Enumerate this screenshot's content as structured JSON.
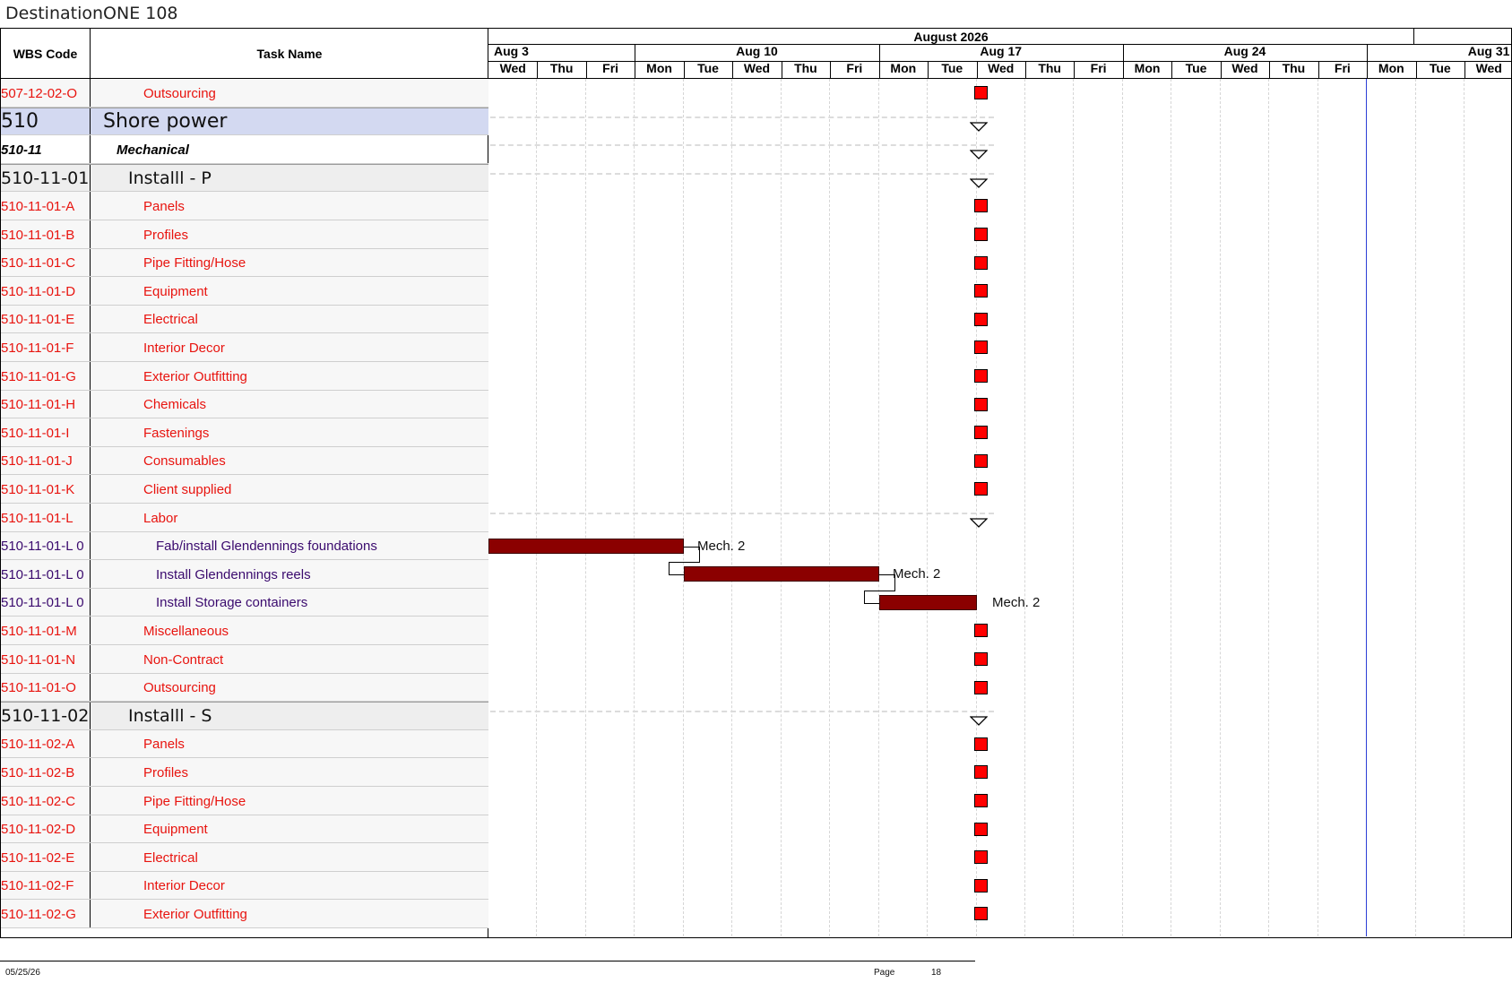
{
  "page": {
    "title": "DestinationONE 108"
  },
  "table_header": {
    "wbs_label": "WBS Code",
    "name_label": "Task Name"
  },
  "timescale": {
    "month_label": "August 2026",
    "weeks": [
      "Aug 3",
      "Aug 10",
      "Aug 17",
      "Aug 24",
      "Aug 31"
    ],
    "days": [
      "Wed",
      "Thu",
      "Fri",
      "Mon",
      "Tue",
      "Wed",
      "Thu",
      "Fri",
      "Mon",
      "Tue",
      "Wed",
      "Thu",
      "Fri",
      "Mon",
      "Tue",
      "Wed",
      "Thu",
      "Fri",
      "Mon",
      "Tue",
      "Wed"
    ]
  },
  "rows": [
    {
      "wbs": "507-12-02-O",
      "name": "Outsourcing",
      "style": "detail",
      "milestone": true
    },
    {
      "wbs": "510",
      "name": "Shore power",
      "style": "top",
      "summary": true
    },
    {
      "wbs": "510-11",
      "name": "Mechanical",
      "style": "l2",
      "summary": true
    },
    {
      "wbs": "510-11-01",
      "name": "Installl - P",
      "style": "l3",
      "summary": true
    },
    {
      "wbs": "510-11-01-A",
      "name": "Panels",
      "style": "detail",
      "milestone": true
    },
    {
      "wbs": "510-11-01-B",
      "name": "Profiles",
      "style": "detail",
      "milestone": true
    },
    {
      "wbs": "510-11-01-C",
      "name": "Pipe Fitting/Hose",
      "style": "detail",
      "milestone": true
    },
    {
      "wbs": "510-11-01-D",
      "name": "Equipment",
      "style": "detail",
      "milestone": true
    },
    {
      "wbs": "510-11-01-E",
      "name": "Electrical",
      "style": "detail",
      "milestone": true
    },
    {
      "wbs": "510-11-01-F",
      "name": "Interior Decor",
      "style": "detail",
      "milestone": true
    },
    {
      "wbs": "510-11-01-G",
      "name": "Exterior Outfitting",
      "style": "detail",
      "milestone": true
    },
    {
      "wbs": "510-11-01-H",
      "name": "Chemicals",
      "style": "detail",
      "milestone": true
    },
    {
      "wbs": "510-11-01-I",
      "name": "Fastenings",
      "style": "detail",
      "milestone": true
    },
    {
      "wbs": "510-11-01-J",
      "name": "Consumables",
      "style": "detail",
      "milestone": true
    },
    {
      "wbs": "510-11-01-K",
      "name": "Client supplied",
      "style": "detail",
      "milestone": true
    },
    {
      "wbs": "510-11-01-L",
      "name": "Labor",
      "style": "detail",
      "summary": true
    },
    {
      "wbs": "510-11-01-L 0",
      "name": "Fab/install Glendennings foundations",
      "style": "task",
      "bar": {
        "start": 0,
        "end": 4
      },
      "resource": "Mech. 2"
    },
    {
      "wbs": "510-11-01-L 0",
      "name": "Install Glendennings reels",
      "style": "task",
      "bar": {
        "start": 4,
        "end": 8
      },
      "resource": "Mech. 2"
    },
    {
      "wbs": "510-11-01-L 0",
      "name": "Install Storage containers",
      "style": "task",
      "bar": {
        "start": 8,
        "end": 10
      },
      "resource": "Mech. 2"
    },
    {
      "wbs": "510-11-01-M",
      "name": "Miscellaneous",
      "style": "detail",
      "milestone": true
    },
    {
      "wbs": "510-11-01-N",
      "name": "Non-Contract",
      "style": "detail",
      "milestone": true
    },
    {
      "wbs": "510-11-01-O",
      "name": "Outsourcing",
      "style": "detail",
      "milestone": true
    },
    {
      "wbs": "510-11-02",
      "name": "Installl - S",
      "style": "l3",
      "summary": true
    },
    {
      "wbs": "510-11-02-A",
      "name": "Panels",
      "style": "detail",
      "milestone": true
    },
    {
      "wbs": "510-11-02-B",
      "name": "Profiles",
      "style": "detail",
      "milestone": true
    },
    {
      "wbs": "510-11-02-C",
      "name": "Pipe Fitting/Hose",
      "style": "detail",
      "milestone": true
    },
    {
      "wbs": "510-11-02-D",
      "name": "Equipment",
      "style": "detail",
      "milestone": true
    },
    {
      "wbs": "510-11-02-E",
      "name": "Electrical",
      "style": "detail",
      "milestone": true
    },
    {
      "wbs": "510-11-02-F",
      "name": "Interior Decor",
      "style": "detail",
      "milestone": true
    },
    {
      "wbs": "510-11-02-G",
      "name": "Exterior Outfitting",
      "style": "detail",
      "milestone": true
    }
  ],
  "milestone_day": "Tue Aug 18",
  "today_line_day": "Mon Aug 31",
  "colors": {
    "detail_text": "#e8140f",
    "task_text": "#3a0a6e",
    "top_band": "#d3d9f1",
    "l3_band": "#eeeeee",
    "milestone": "#ff0000",
    "bar": "#8b0000",
    "today_line": "#2c3ed6"
  },
  "footer": {
    "date": "05/25/26",
    "page_label": "Page",
    "page_number": "18"
  }
}
